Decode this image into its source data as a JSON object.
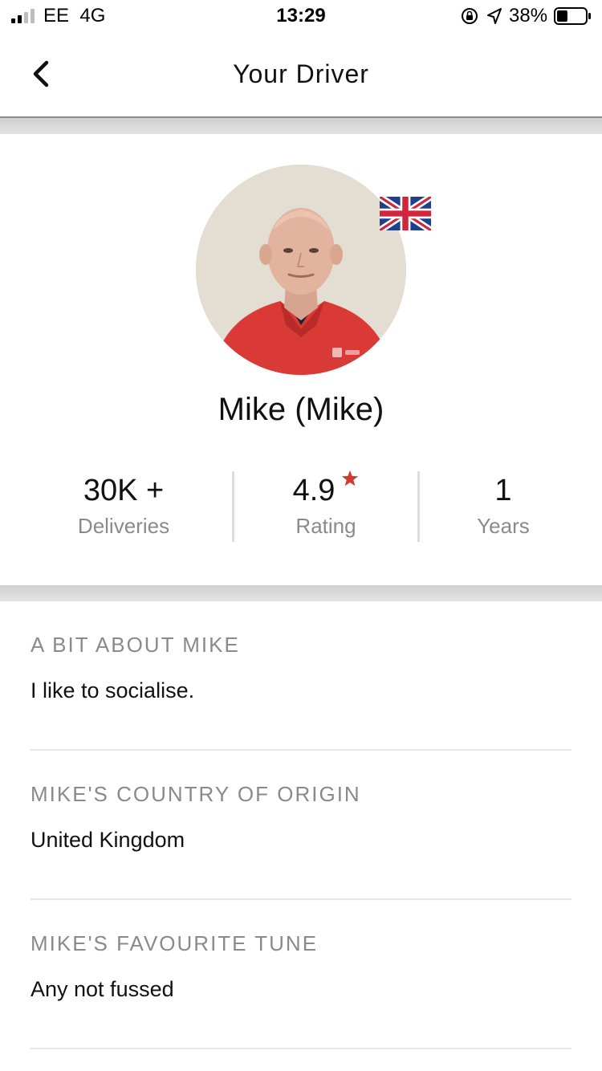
{
  "status_bar": {
    "carrier": "EE",
    "network": "4G",
    "time": "13:29",
    "battery_percent": "38%",
    "battery_level": 0.38
  },
  "header": {
    "title": "Your Driver"
  },
  "driver": {
    "name": "Mike (Mike)",
    "flag": "united-kingdom-flag-icon"
  },
  "stats": [
    {
      "value": "30K +",
      "label": "Deliveries"
    },
    {
      "value": "4.9",
      "label": "Rating"
    },
    {
      "value": "1",
      "label": "Years"
    }
  ],
  "sections": [
    {
      "heading": "A BIT ABOUT MIKE",
      "text": "I like to socialise."
    },
    {
      "heading": "MIKE'S COUNTRY OF ORIGIN",
      "text": "United Kingdom"
    },
    {
      "heading": "MIKE'S FAVOURITE TUNE",
      "text": "Any not fussed"
    }
  ],
  "colors": {
    "star": "#d03a2f",
    "muted_text": "#8a8a8a",
    "divider": "#e6e6e6"
  }
}
